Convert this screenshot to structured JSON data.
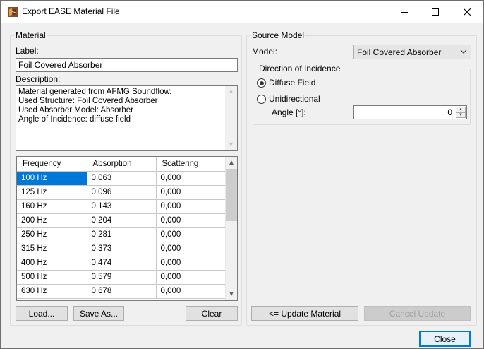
{
  "window": {
    "title": "Export EASE Material File"
  },
  "material": {
    "group_label": "Material",
    "label_caption": "Label:",
    "label_value": "Foil Covered Absorber",
    "description_caption": "Description:",
    "description_lines": [
      "Material generated from AFMG Soundflow.",
      "Used Structure: Foil Covered Absorber",
      "Used Absorber Model: Absorber",
      "Angle of Incidence: diffuse field"
    ],
    "table": {
      "headers": [
        "Frequency",
        "Absorption",
        "Scattering"
      ],
      "rows": [
        [
          "100 Hz",
          "0,063",
          "0,000"
        ],
        [
          "125 Hz",
          "0,096",
          "0,000"
        ],
        [
          "160 Hz",
          "0,143",
          "0,000"
        ],
        [
          "200 Hz",
          "0,204",
          "0,000"
        ],
        [
          "250 Hz",
          "0,281",
          "0,000"
        ],
        [
          "315 Hz",
          "0,373",
          "0,000"
        ],
        [
          "400 Hz",
          "0,474",
          "0,000"
        ],
        [
          "500 Hz",
          "0,579",
          "0,000"
        ],
        [
          "630 Hz",
          "0,678",
          "0,000"
        ]
      ]
    },
    "load_label": "Load...",
    "save_as_label": "Save As...",
    "clear_label": "Clear"
  },
  "source_model": {
    "group_label": "Source Model",
    "model_caption": "Model:",
    "model_value": "Foil Covered Absorber",
    "incidence": {
      "group_label": "Direction of Incidence",
      "diffuse_label": "Diffuse Field",
      "unidirectional_label": "Unidirectional",
      "selected": "diffuse",
      "angle_caption": "Angle [°]:",
      "angle_value": "0"
    },
    "update_label": "<= Update Material",
    "cancel_update_label": "Cancel Update"
  },
  "close_label": "Close",
  "colors": {
    "selection": "#0078d7",
    "accent_border": "#0078d7"
  },
  "icons": [
    "app-icon",
    "minimize-icon",
    "maximize-icon",
    "close-icon",
    "chevron-down-icon",
    "scroll-up-icon",
    "scroll-down-icon"
  ]
}
